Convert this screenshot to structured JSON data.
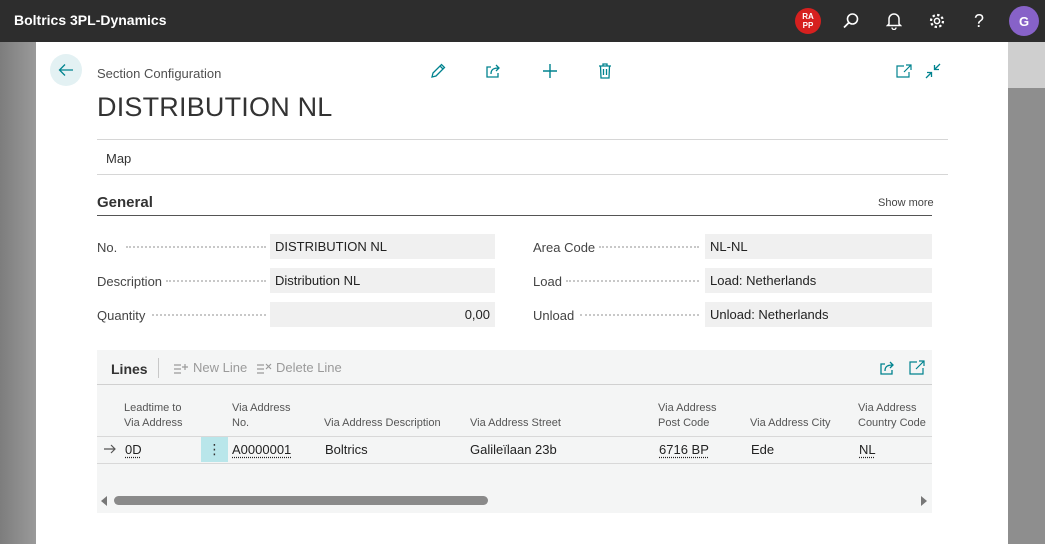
{
  "app": {
    "title": "Boltrics 3PL-Dynamics",
    "badge": "RA\nPP",
    "avatar_initial": "G"
  },
  "topbar_icons": [
    "search-icon",
    "bell-icon",
    "gear-icon",
    "help-icon"
  ],
  "page": {
    "caption": "Section Configuration",
    "title": "DISTRIBUTION NL",
    "actions": [
      "edit-icon",
      "share-icon",
      "add-icon",
      "delete-icon"
    ],
    "right_actions": [
      "open-new-window-icon",
      "collapse-icon"
    ],
    "menu": {
      "map": "Map"
    }
  },
  "general": {
    "heading": "General",
    "show_more": "Show more",
    "left": [
      {
        "label": "No.",
        "value": "DISTRIBUTION NL"
      },
      {
        "label": "Description",
        "value": "Distribution NL"
      },
      {
        "label": "Quantity",
        "value": "0,00"
      }
    ],
    "right": [
      {
        "label": "Area Code",
        "value": "NL-NL"
      },
      {
        "label": "Load",
        "value": "Load: Netherlands"
      },
      {
        "label": "Unload",
        "value": "Unload: Netherlands"
      }
    ]
  },
  "lines": {
    "title": "Lines",
    "new_line": "New Line",
    "delete_line": "Delete Line",
    "columns": [
      "Leadtime to Via Address",
      "Via Address No.",
      "Via Address Description",
      "Via Address Street",
      "Via Address Post Code",
      "Via Address City",
      "Via Address Country Code"
    ],
    "rows": [
      {
        "leadtime": "0D",
        "no": "A0000001",
        "description": "Boltrics",
        "street": "Galileïlaan 23b",
        "post_code": "6716 BP",
        "city": "Ede",
        "country": "NL"
      }
    ]
  },
  "colors": {
    "accent": "#00838f",
    "topbar": "#2d2d2d",
    "avatar": "#8762c8",
    "badge": "#d6201f",
    "row_selected": "#b9e6ea"
  }
}
